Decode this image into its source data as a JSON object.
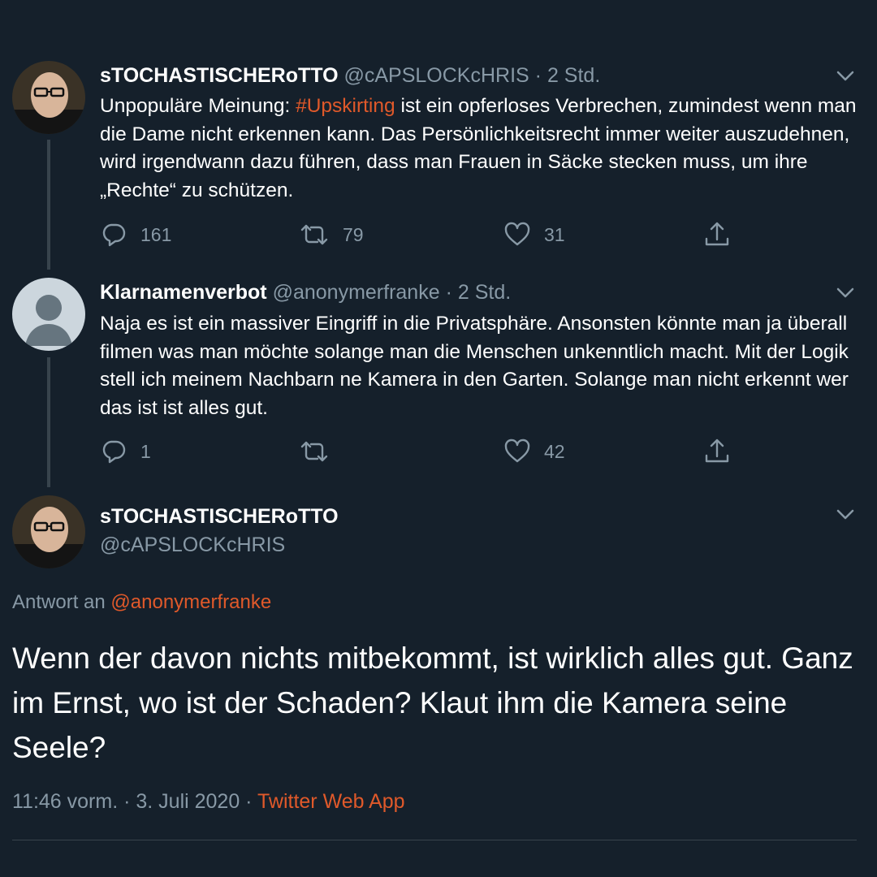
{
  "colors": {
    "background": "#15202b",
    "accent": "#e0592a",
    "secondary_text": "#8899a6",
    "divider": "#38444d"
  },
  "tweets": [
    {
      "display_name": "sTOCHASTISCHERoTTO",
      "handle": "@cAPSLOCKcHRIS",
      "separator": "·",
      "time": "2 Std.",
      "text_before": "Unpopuläre Meinung: ",
      "hashtag": "#Upskirting",
      "text_after": " ist ein opferloses Verbrechen, zumindest wenn man die Dame nicht erkennen kann. Das Persönlichkeitsrecht immer weiter auszudehnen, wird irgendwann dazu führen, dass man Frauen in Säcke stecken muss, um ihre „Rechte“ zu schützen.",
      "replies": "161",
      "retweets": "79",
      "likes": "31",
      "avatar_icon": "user-photo-avatar"
    },
    {
      "display_name": "Klarnamenverbot",
      "handle": "@anonymerfranke",
      "separator": "·",
      "time": "2 Std.",
      "text": "Naja es ist ein massiver Eingriff in die Privatsphäre. Ansonsten könnte man ja überall filmen was man möchte solange man die Menschen unkenntlich macht. Mit der Logik stell ich meinem Nachbarn ne Kamera in den Garten. Solange man nicht erkennt wer das ist ist alles gut.",
      "replies": "1",
      "retweets": "",
      "likes": "42",
      "avatar_icon": "default-avatar"
    }
  ],
  "main_tweet": {
    "display_name": "sTOCHASTISCHERoTTO",
    "handle": "@cAPSLOCKcHRIS",
    "reply_prefix": "Antwort an",
    "reply_mention": "@anonymerfranke",
    "text": "Wenn der davon nichts mitbekommt, ist wirklich alles gut. Ganz im Ernst, wo ist der Schaden? Klaut ihm die Kamera seine Seele?",
    "timestamp": "11:46 vorm. · 3. Juli 2020 · ",
    "source": "Twitter Web App"
  },
  "icons": [
    "chevron-down-icon",
    "reply-icon",
    "retweet-icon",
    "like-icon",
    "share-icon"
  ]
}
